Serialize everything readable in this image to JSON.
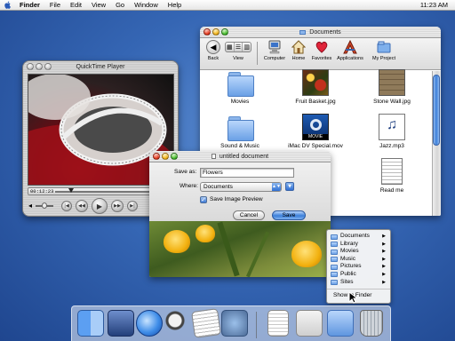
{
  "menubar": {
    "apple_icon": "apple-icon",
    "items": [
      "Finder",
      "File",
      "Edit",
      "View",
      "Go",
      "Window",
      "Help"
    ],
    "clock": "11:23 AM"
  },
  "finder": {
    "title": "Documents",
    "toolbar": {
      "back": "Back",
      "view": "View",
      "computer": "Computer",
      "home": "Home",
      "favorites": "Favorites",
      "applications": "Applications",
      "my_project": "My Project"
    },
    "files": [
      {
        "name": "Movies",
        "icon": "folder-icon"
      },
      {
        "name": "Fruit Basket.jpg",
        "icon": "image-icon"
      },
      {
        "name": "Stone Wall.jpg",
        "icon": "image-icon"
      },
      {
        "name": "Sound & Music",
        "icon": "folder-icon"
      },
      {
        "name": "iMac DV Special.mov",
        "icon": "movie-icon",
        "badge": "MOVIE"
      },
      {
        "name": "Jazz.mp3",
        "icon": "audio-icon"
      },
      {
        "name": "Read me",
        "icon": "document-icon"
      }
    ]
  },
  "quicktime": {
    "title": "QuickTime Player",
    "time": "00:12:23",
    "playhead_fraction": 0.12
  },
  "save_dialog": {
    "title": "untitled document",
    "save_as_label": "Save as:",
    "save_as_value": "Flowers",
    "where_label": "Where:",
    "where_value": "Documents",
    "checkbox_label": "Save Image Preview",
    "checkbox_checked": true,
    "cancel": "Cancel",
    "save": "Save"
  },
  "dock_menu": {
    "items": [
      "Documents",
      "Library",
      "Movies",
      "Music",
      "Pictures",
      "Public",
      "Sites"
    ],
    "show_in_finder": "Show in Finder"
  },
  "dock": {
    "apps": [
      "finder-icon",
      "mail-icon",
      "internet-explorer-icon",
      "sherlock-icon",
      "textedit-icon",
      "system-preferences-icon"
    ],
    "docs": [
      "document-icon",
      "window-icon",
      "documents-folder-icon",
      "trash-icon"
    ]
  }
}
